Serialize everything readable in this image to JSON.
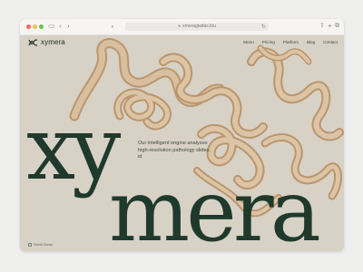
{
  "browser": {
    "url": "xmeragiadas.ktu",
    "icons": {
      "back": "chevron-left-icon",
      "forward": "chevron-right-icon",
      "sidebar": "sidebar-icon",
      "shield": "shield-icon",
      "reload": "reload-icon",
      "share": "share-icon",
      "new_tab": "plus-icon",
      "tabs": "tabs-icon"
    }
  },
  "site": {
    "logo_text": "xymera",
    "menu": [
      "Menu",
      "Pricing",
      "Platform",
      "Blog",
      "Contact"
    ],
    "hero_word_top": "xy",
    "hero_word_bottom": "mera",
    "tagline": "Our intelligent engine analyzes high-resolution pathology slides, id",
    "scroll_label": "Scroll Down"
  },
  "colors": {
    "background": "#d8d1c5",
    "headline": "#1f3a2c",
    "ribbon": "#cdb08d"
  }
}
